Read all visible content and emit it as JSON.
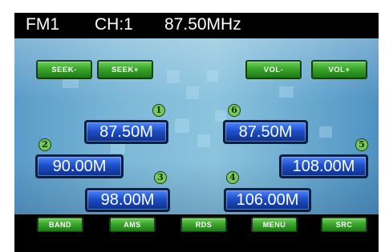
{
  "header": {
    "band": "FM1",
    "channel": "CH:1",
    "frequency": "87.50MHz"
  },
  "controls": {
    "seek_down": "SEEK-",
    "seek_up": "SEEK+",
    "vol_down": "VOL-",
    "vol_up": "VOL+"
  },
  "presets": [
    {
      "number": "1",
      "frequency": "87.50M"
    },
    {
      "number": "2",
      "frequency": "90.00M"
    },
    {
      "number": "3",
      "frequency": "98.00M"
    },
    {
      "number": "4",
      "frequency": "106.00M"
    },
    {
      "number": "5",
      "frequency": "108.00M"
    },
    {
      "number": "6",
      "frequency": "87.50M"
    }
  ],
  "bottom_menu": {
    "band": "BAND",
    "ams": "AMS",
    "rds": "RDS",
    "menu": "MENU",
    "src": "SRC"
  },
  "colors": {
    "panel_blue": "#7cb8d8",
    "button_green": "#39a52a",
    "preset_blue": "#1e4fc8"
  }
}
